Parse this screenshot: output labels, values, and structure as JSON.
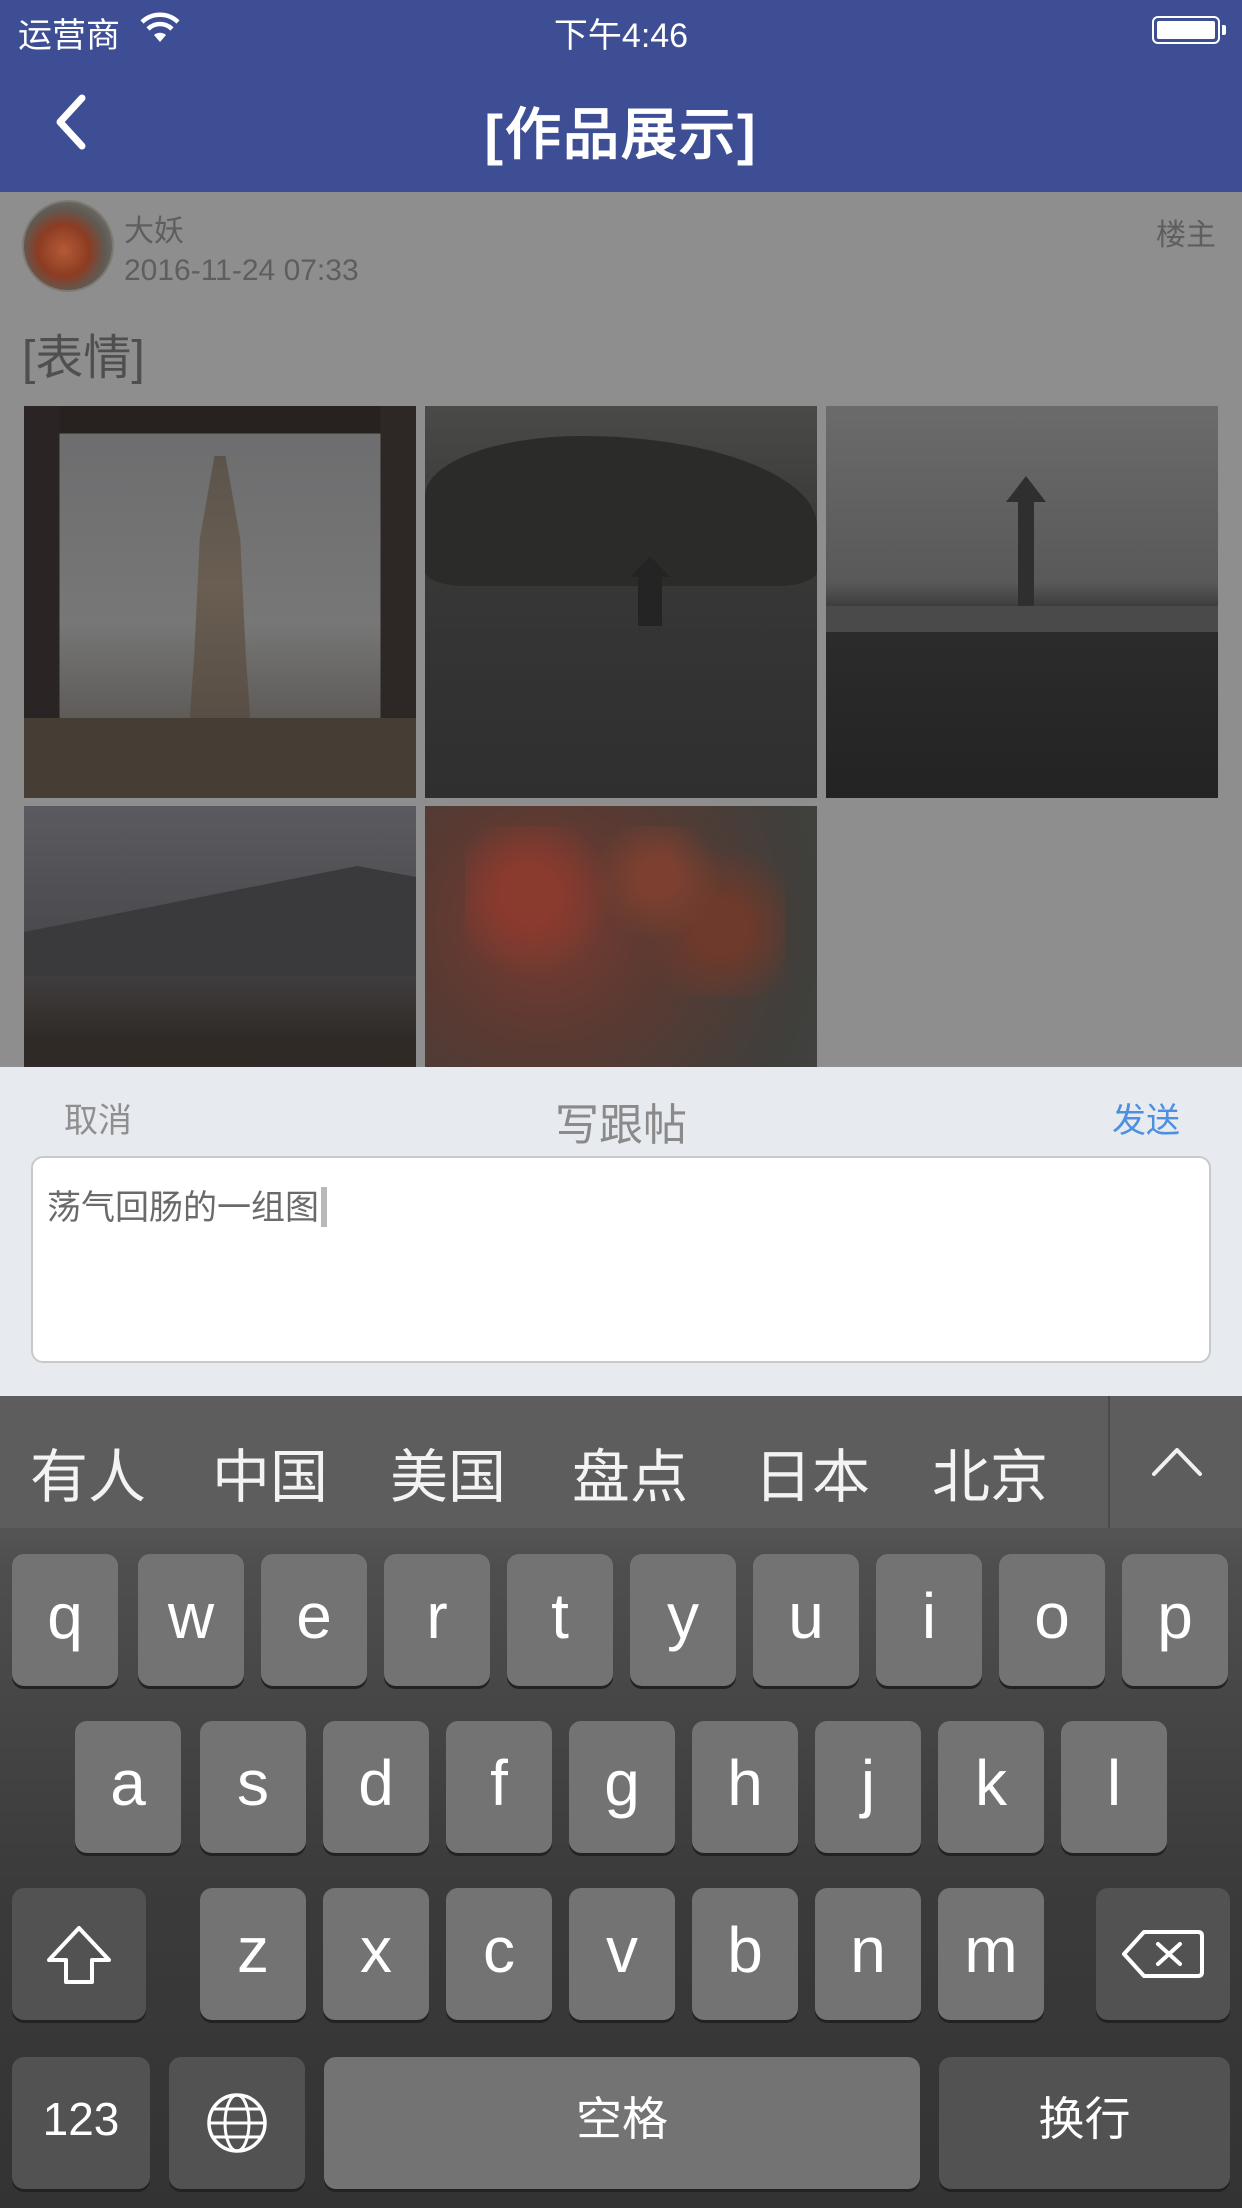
{
  "status_bar": {
    "carrier": "运营商",
    "time": "下午4:46"
  },
  "nav": {
    "title": "[作品展示]",
    "back_icon": "chevron-left-icon"
  },
  "post": {
    "author": "大妖",
    "timestamp": "2016-11-24 07:33",
    "floor_badge": "楼主",
    "text": "[表情]",
    "photos": [
      "pagoda-through-window",
      "lake-pavilion-snow",
      "bridge-lantern-snow",
      "temple-roof",
      "red-maple-leaves"
    ]
  },
  "composer": {
    "cancel_label": "取消",
    "title": "写跟帖",
    "send_label": "发送",
    "input_value": "荡气回肠的一组图",
    "send_color": "#4d8fe0"
  },
  "keyboard": {
    "suggestions": [
      "有人",
      "中国",
      "美国",
      "盘点",
      "日本",
      "北京"
    ],
    "row1": [
      "q",
      "w",
      "e",
      "r",
      "t",
      "y",
      "u",
      "i",
      "o",
      "p"
    ],
    "row2": [
      "a",
      "s",
      "d",
      "f",
      "g",
      "h",
      "j",
      "k",
      "l"
    ],
    "row3": [
      "z",
      "x",
      "c",
      "v",
      "b",
      "n",
      "m"
    ],
    "numbers_label": "123",
    "space_label": "空格",
    "return_label": "换行"
  },
  "theme": {
    "nav_color": "#3e4e94"
  }
}
